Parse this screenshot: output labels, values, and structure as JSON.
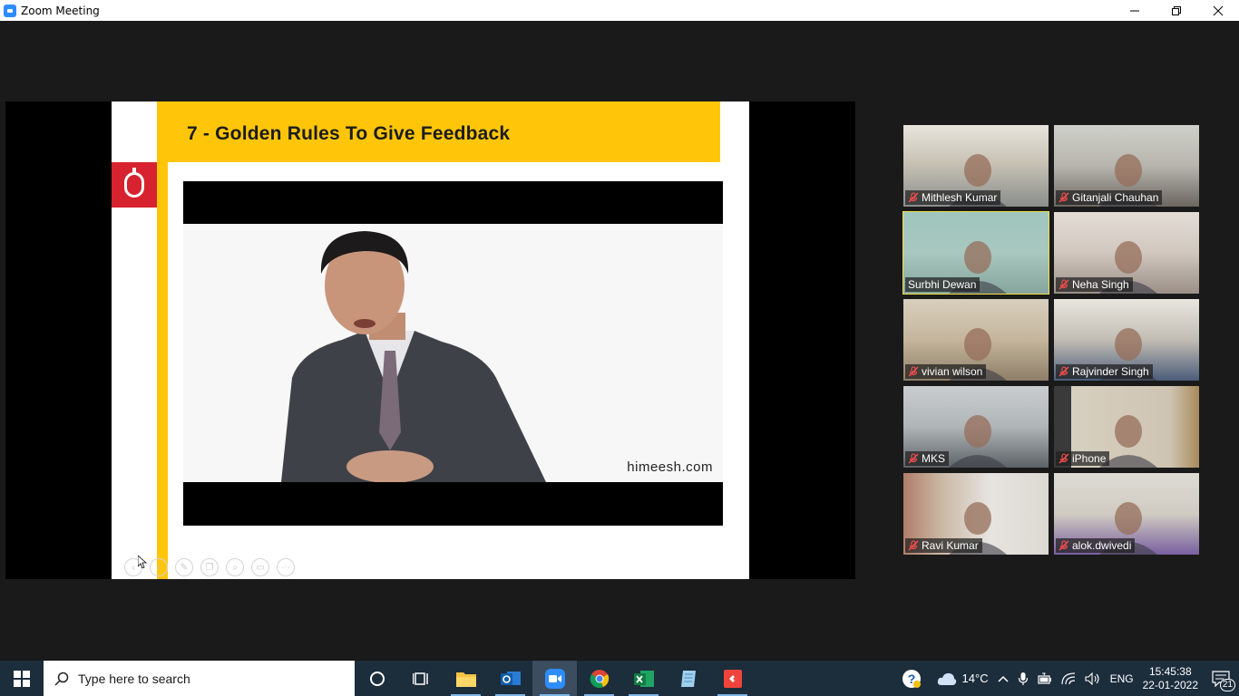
{
  "window": {
    "title": "Zoom Meeting"
  },
  "slide": {
    "title": "7  - Golden Rules To Give Feedback",
    "watermark": "himeesh.com"
  },
  "participants": [
    {
      "name": "Mithlesh Kumar",
      "muted": true,
      "active": false
    },
    {
      "name": "Gitanjali Chauhan",
      "muted": true,
      "active": false
    },
    {
      "name": "Surbhi Dewan",
      "muted": false,
      "active": true
    },
    {
      "name": "Neha Singh",
      "muted": true,
      "active": false
    },
    {
      "name": "vivian wilson",
      "muted": true,
      "active": false
    },
    {
      "name": "Rajvinder Singh",
      "muted": true,
      "active": false
    },
    {
      "name": "MKS",
      "muted": true,
      "active": false
    },
    {
      "name": "iPhone",
      "muted": true,
      "active": false
    },
    {
      "name": "Ravi Kumar",
      "muted": true,
      "active": false
    },
    {
      "name": "alok.dwivedi",
      "muted": true,
      "active": false
    }
  ],
  "taskbar": {
    "search_placeholder": "Type here to search",
    "weather": "14°C",
    "language": "ENG",
    "time": "15:45:38",
    "date": "22-01-2022",
    "notifications": "21"
  },
  "colors": {
    "slide_accent": "#ffc609",
    "logo_red": "#d6232f",
    "active_speaker": "#f6e24a",
    "taskbar_bg": "#1c2d3c"
  }
}
